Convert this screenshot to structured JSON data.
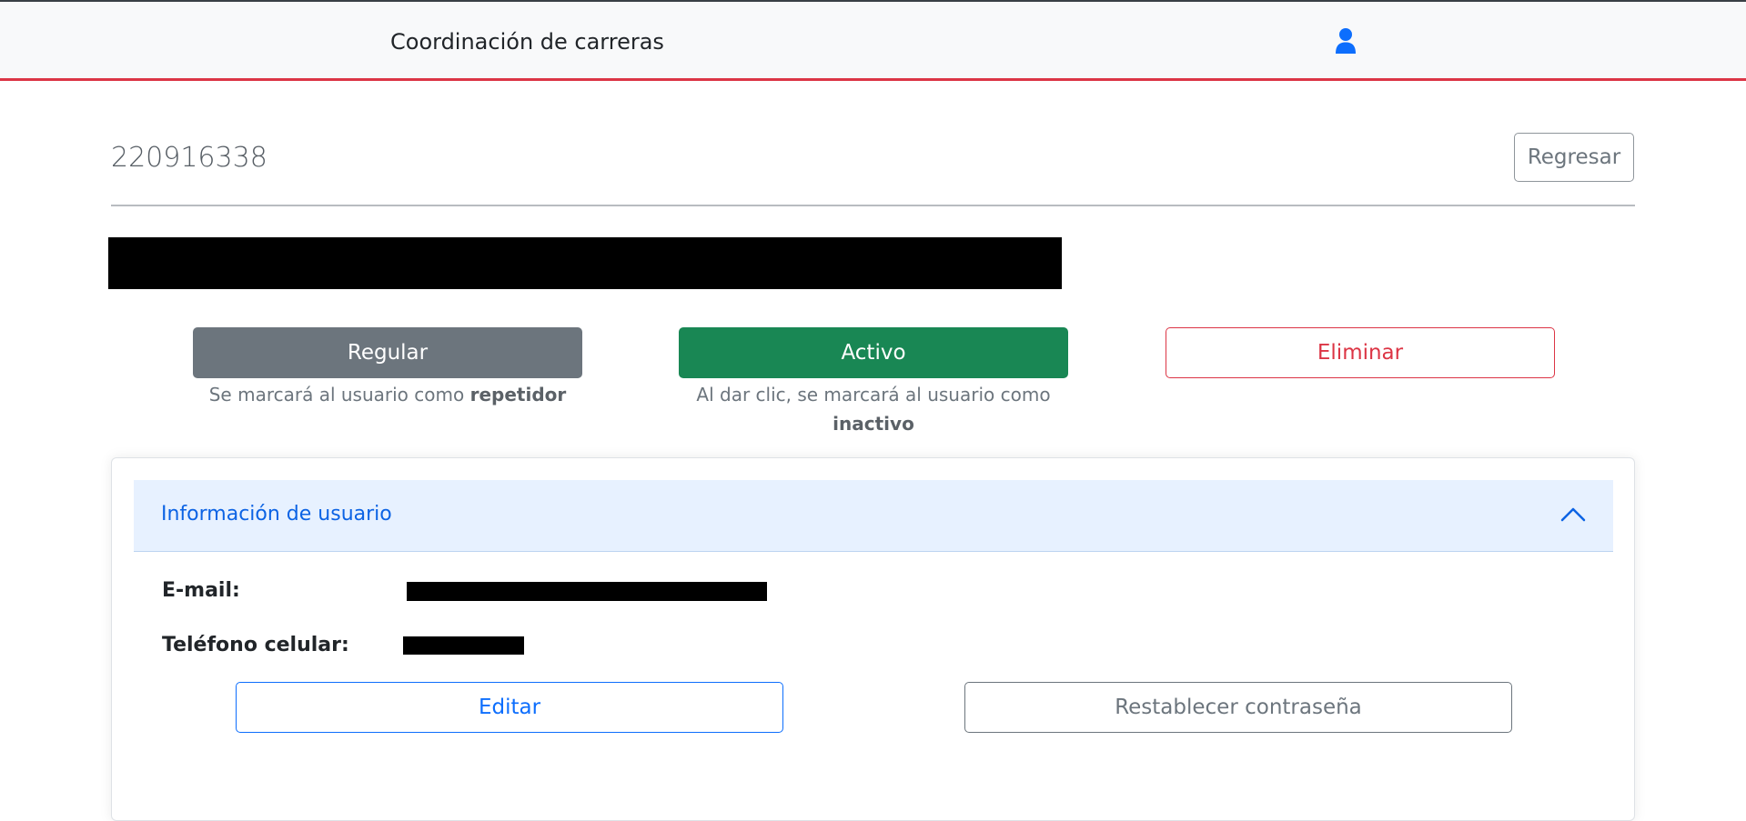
{
  "navbar": {
    "brand": "Coordinación de carreras",
    "icon": "user-icon"
  },
  "page": {
    "title": "220916338",
    "back_label": "Regresar"
  },
  "status": {
    "regular": {
      "label": "Regular",
      "hint_prefix": "Se marcará al usuario como ",
      "hint_bold": "repetidor"
    },
    "activo": {
      "label": "Activo",
      "hint_prefix": "Al dar clic, se marcará al usuario como ",
      "hint_bold": "inactivo"
    },
    "eliminar": {
      "label": "Eliminar"
    }
  },
  "user_info": {
    "header": "Información de usuario",
    "email_label": "E-mail:",
    "phone_label": "Teléfono celular:",
    "edit_label": "Editar",
    "reset_label": "Restablecer contraseña"
  },
  "colors": {
    "accent_red": "#dc3545",
    "success": "#198754",
    "secondary": "#6c757d",
    "primary": "#0d6efd"
  }
}
